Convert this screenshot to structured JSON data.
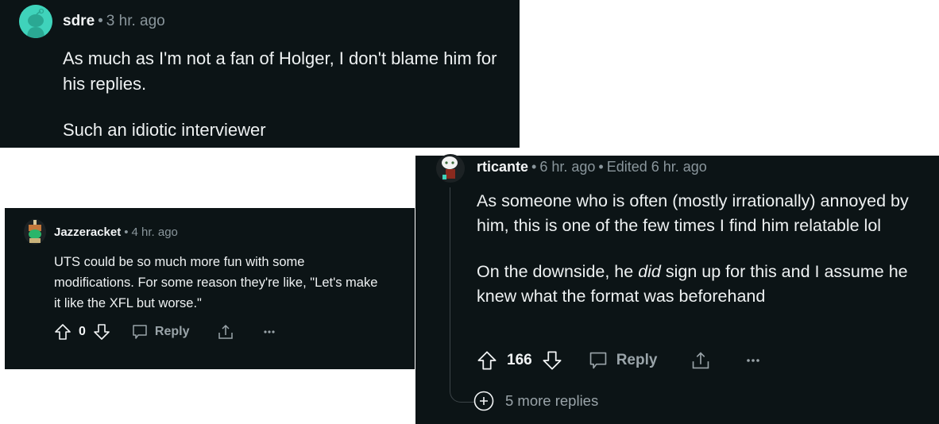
{
  "colors": {
    "panel_bg": "#0c1416",
    "text_primary": "#eef1f2",
    "text_muted": "#8a969c",
    "avatar_teal": "#3fd3bb",
    "page_bg": "#ffffff"
  },
  "comments": [
    {
      "username": "sdre",
      "time": "3 hr. ago",
      "avatar_icon": "snoo-avatar-icon",
      "body": [
        "As much as I'm not a fan of Holger, I don't blame him for his replies.",
        "Such an idiotic interviewer"
      ]
    },
    {
      "username": "Jazzeracket",
      "time": "4 hr. ago",
      "avatar_icon": "custom-avatar-icon",
      "body": [
        "UTS could be so much more fun with some modifications. For some reason they're like, \"Let's make it like the XFL but worse.\""
      ],
      "score": "0",
      "reply_label": "Reply",
      "upvote_icon": "upvote-arrow-icon",
      "downvote_icon": "downvote-arrow-icon",
      "reply_icon": "comment-bubble-icon",
      "share_icon": "share-icon",
      "more_icon": "ellipsis-icon"
    },
    {
      "username": "rticante",
      "time": "6 hr. ago",
      "edited": "Edited 6 hr. ago",
      "avatar_icon": "custom-avatar-icon",
      "body_p1": "As someone who is often (mostly irrationally) annoyed by him, this is one of the few times I find him relatable lol",
      "body_p2_before": "On the downside, he ",
      "body_p2_em": "did",
      "body_p2_after": " sign up for this and I assume he knew what the format was beforehand",
      "score": "166",
      "reply_label": "Reply",
      "more_replies": "5 more replies",
      "upvote_icon": "upvote-arrow-icon",
      "downvote_icon": "downvote-arrow-icon",
      "reply_icon": "comment-bubble-icon",
      "share_icon": "share-icon",
      "more_icon": "ellipsis-icon",
      "expand_icon": "plus-circle-icon"
    }
  ],
  "separator": "•"
}
